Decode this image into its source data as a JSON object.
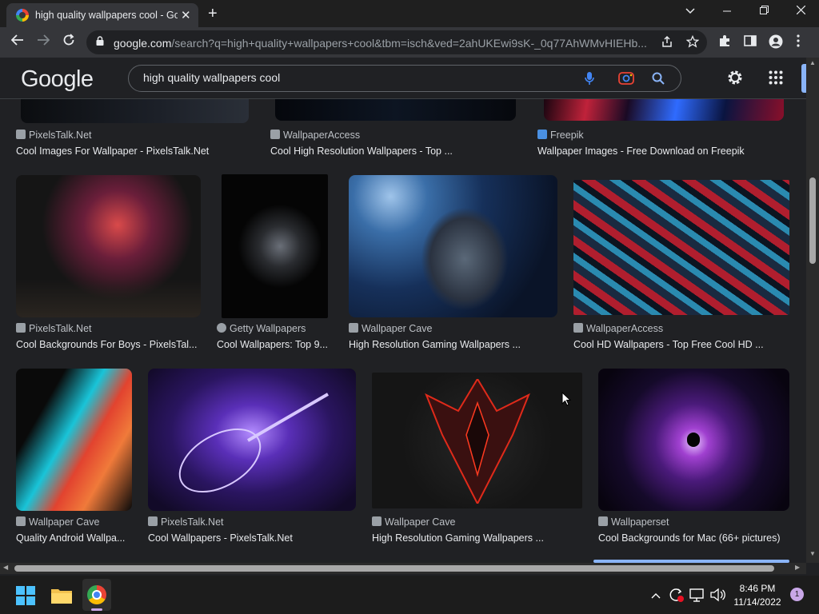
{
  "browser": {
    "tab_title": "high quality wallpapers cool - Go",
    "tab_close": "✕",
    "new_tab": "+",
    "url_host": "google.com",
    "url_path": "/search?q=high+quality+wallpapers+cool&tbm=isch&ved=2ahUKEwi9sK-_0q77AhWMvHIEHb...",
    "profile_glyph": "●"
  },
  "google": {
    "logo": "Google",
    "query": "high quality wallpapers cool"
  },
  "results": {
    "row1": [
      {
        "source": "PixelsTalk.Net",
        "title": "Cool Images For Wallpaper - PixelsTalk.Net"
      },
      {
        "source": "WallpaperAccess",
        "title": "Cool High Resolution Wallpapers - Top ..."
      },
      {
        "source": "Freepik",
        "title": "Wallpaper Images - Free Download on Freepik"
      }
    ],
    "row2": [
      {
        "source": "PixelsTalk.Net",
        "title": "Cool Backgrounds For Boys - PixelsTal..."
      },
      {
        "source": "Getty Wallpapers",
        "title": "Cool Wallpapers: Top 9..."
      },
      {
        "source": "Wallpaper Cave",
        "title": "High Resolution Gaming Wallpapers ..."
      },
      {
        "source": "WallpaperAccess",
        "title": "Cool HD Wallpapers - Top Free Cool HD ..."
      }
    ],
    "row3": [
      {
        "source": "Wallpaper Cave",
        "title": "Quality Android Wallpa..."
      },
      {
        "source": "PixelsTalk.Net",
        "title": "Cool Wallpapers - PixelsTalk.Net"
      },
      {
        "source": "Wallpaper Cave",
        "title": "High Resolution Gaming Wallpapers ..."
      },
      {
        "source": "Wallpaperset",
        "title": "Cool Backgrounds for Mac (66+ pictures)"
      }
    ]
  },
  "taskbar": {
    "time": "8:46 PM",
    "date": "11/14/2022",
    "notifications": "1"
  },
  "colors": {
    "page_bg": "#202124",
    "toolbar_bg": "#35363a",
    "text": "#e8eaed",
    "muted": "#bdc1c6"
  }
}
